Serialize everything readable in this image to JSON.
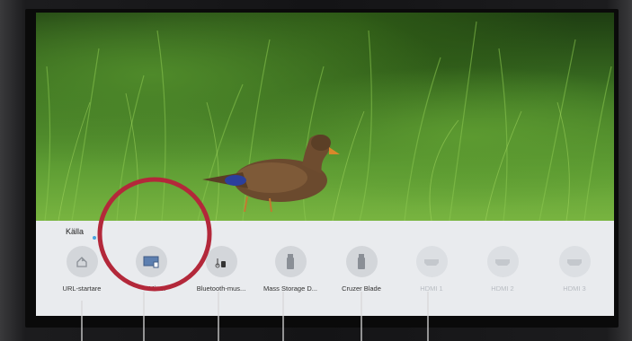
{
  "panel": {
    "title": "Källa"
  },
  "sources": [
    {
      "label": "URL-startare",
      "icon": "url-launcher-icon",
      "dimmed": false
    },
    {
      "label": "Mirror",
      "icon": "screen-mirroring-icon",
      "dimmed": false
    },
    {
      "label": "Bluetooth-mus...",
      "icon": "bluetooth-music-icon",
      "dimmed": false
    },
    {
      "label": "Mass Storage D...",
      "icon": "usb-storage-icon",
      "dimmed": false
    },
    {
      "label": "Cruzer Blade",
      "icon": "usb-drive-icon",
      "dimmed": false
    },
    {
      "label": "HDMI 1",
      "icon": "hdmi-icon",
      "dimmed": true
    },
    {
      "label": "HDMI 2",
      "icon": "hdmi-icon",
      "dimmed": true
    },
    {
      "label": "HDMI 3",
      "icon": "hdmi-icon",
      "dimmed": true
    }
  ],
  "colors": {
    "annotation_circle": "#b3283a",
    "panel_background": "#e9ebee",
    "indicator": "#4aa3df"
  }
}
